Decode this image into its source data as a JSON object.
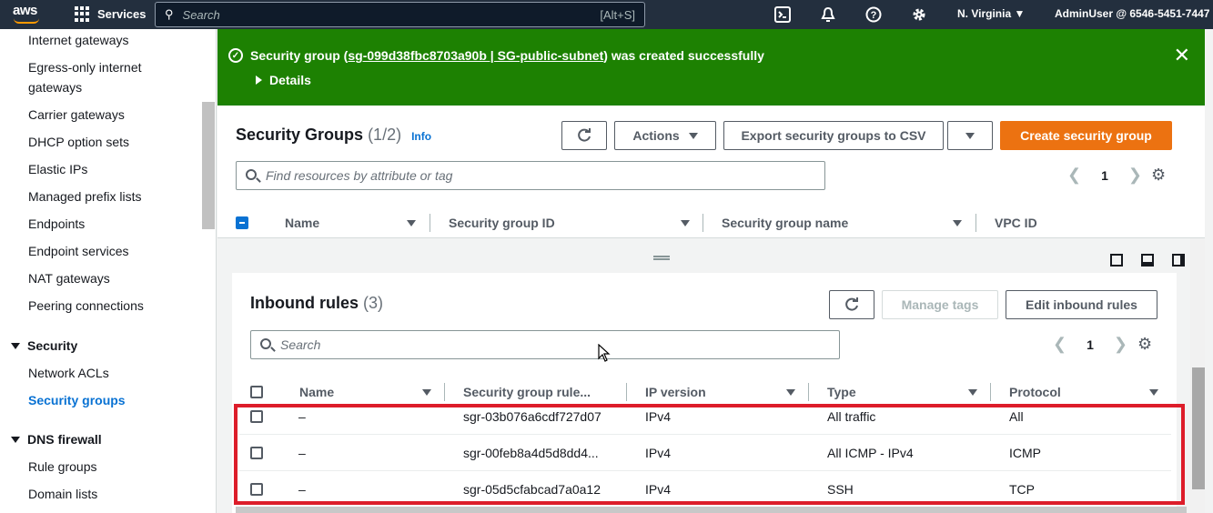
{
  "topbar": {
    "logo": "aws",
    "services_label": "Services",
    "search_placeholder": "Search",
    "search_shortcut": "[Alt+S]",
    "region": "N. Virginia",
    "account": "AdminUser @ 6546-5451-7447",
    "icons": [
      "cloudshell-icon",
      "bell-icon",
      "help-icon",
      "gear-icon"
    ]
  },
  "sidebar": {
    "items": [
      {
        "label": "Internet gateways"
      },
      {
        "label": "Egress-only internet"
      },
      {
        "label": "gateways"
      },
      {
        "label": "Carrier gateways"
      },
      {
        "label": "DHCP option sets"
      },
      {
        "label": "Elastic IPs"
      },
      {
        "label": "Managed prefix lists"
      },
      {
        "label": "Endpoints"
      },
      {
        "label": "Endpoint services"
      },
      {
        "label": "NAT gateways"
      },
      {
        "label": "Peering connections"
      }
    ],
    "security_section": "Security",
    "security_items": [
      "Network ACLs",
      "Security groups"
    ],
    "dns_section": "DNS firewall",
    "dns_items": [
      "Rule groups",
      "Domain lists"
    ]
  },
  "banner": {
    "prefix": "Security group (",
    "link": "sg-099d38fbc8703a90b | SG-public-subnet",
    "suffix": ") was created successfully",
    "details": "Details",
    "color": "#1d8102"
  },
  "security_groups": {
    "title": "Security Groups",
    "count": "(1/2)",
    "info": "Info",
    "actions_label": "Actions",
    "export_label": "Export security groups to CSV",
    "create_label": "Create security group",
    "search_placeholder": "Find resources by attribute or tag",
    "page": "1",
    "columns": [
      "Name",
      "Security group ID",
      "Security group name",
      "VPC ID"
    ]
  },
  "inbound": {
    "title": "Inbound rules",
    "count": "(3)",
    "manage_tags_label": "Manage tags",
    "edit_label": "Edit inbound rules",
    "search_placeholder": "Search",
    "page": "1",
    "columns": [
      "Name",
      "Security group rule...",
      "IP version",
      "Type",
      "Protocol"
    ],
    "rows": [
      {
        "name": "–",
        "rule_id": "sgr-03b076a6cdf727d07",
        "ip_version": "IPv4",
        "type": "All traffic",
        "protocol": "All"
      },
      {
        "name": "–",
        "rule_id": "sgr-00feb8a4d5d8dd4...",
        "ip_version": "IPv4",
        "type": "All ICMP - IPv4",
        "protocol": "ICMP"
      },
      {
        "name": "–",
        "rule_id": "sgr-05d5cfabcad7a0a12",
        "ip_version": "IPv4",
        "type": "SSH",
        "protocol": "TCP"
      }
    ]
  }
}
